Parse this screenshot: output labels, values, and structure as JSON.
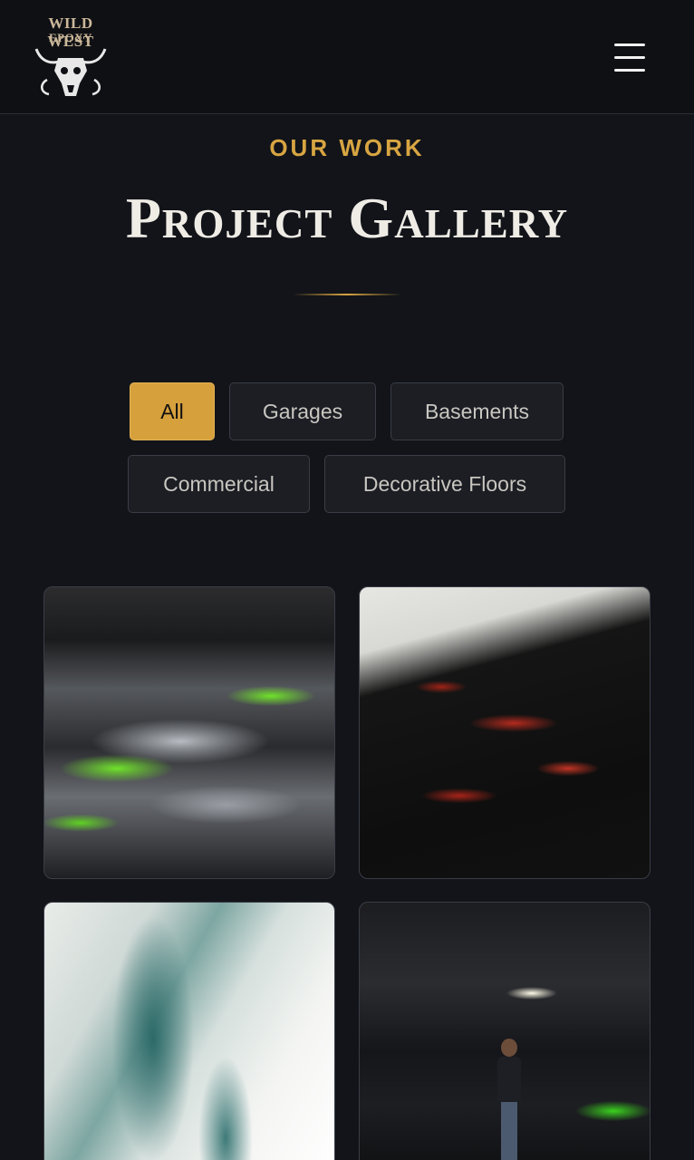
{
  "header": {
    "logo_line1": "WILD WEST",
    "logo_line2": "EPOXY",
    "menu_icon": "hamburger-menu-icon"
  },
  "section": {
    "eyebrow": "OUR WORK",
    "title": "Project Gallery"
  },
  "filters": [
    {
      "label": "All",
      "active": true
    },
    {
      "label": "Garages",
      "active": false
    },
    {
      "label": "Basements",
      "active": false
    },
    {
      "label": "Commercial",
      "active": false
    },
    {
      "label": "Decorative Floors",
      "active": false
    }
  ],
  "gallery": [
    {
      "name": "green-metallic-epoxy-floor"
    },
    {
      "name": "black-red-marble-epoxy-floor"
    },
    {
      "name": "teal-white-marble-epoxy-floor"
    },
    {
      "name": "commercial-space-epoxy-floor"
    }
  ],
  "colors": {
    "accent": "#d6a03c",
    "background": "#121419",
    "header_bg": "#0f1014"
  }
}
